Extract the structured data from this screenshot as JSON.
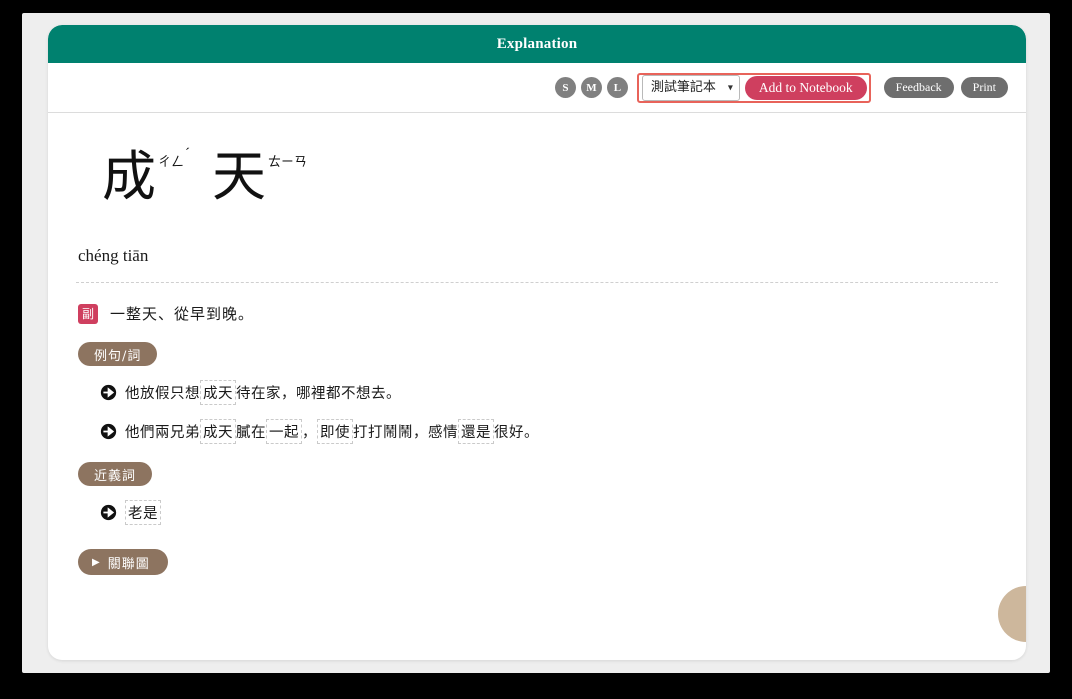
{
  "header": {
    "title": "Explanation"
  },
  "toolbar": {
    "size_buttons": [
      {
        "label": "S",
        "name": "font-size-small"
      },
      {
        "label": "M",
        "name": "font-size-medium"
      },
      {
        "label": "L",
        "name": "font-size-large"
      }
    ],
    "notebook_select": {
      "value": "測試筆記本",
      "options": [
        "測試筆記本"
      ],
      "caret": "⌄"
    },
    "add_to_notebook_label": "Add to Notebook",
    "feedback_label": "Feedback",
    "print_label": "Print",
    "focus_outline_color": "#e8635a",
    "accent_color": "#cf3f5f"
  },
  "entry": {
    "headword_chars": [
      {
        "char": "成",
        "zhuyin": "ㄔㄥ",
        "tone": "ˊ"
      },
      {
        "char": "天",
        "zhuyin": "ㄊㄧㄢ",
        "tone": ""
      }
    ],
    "pinyin": "chéng tiān",
    "part_of_speech_badge": "副",
    "definition": "一整天、從早到晚。",
    "examples_section_label": "例句/詞",
    "examples": [
      {
        "parts": [
          {
            "text": "他放假只想",
            "highlight": false
          },
          {
            "text": "成天",
            "highlight": true
          },
          {
            "text": "待在家，哪裡都不想去。",
            "highlight": false
          }
        ]
      },
      {
        "parts": [
          {
            "text": "他們兩兄弟",
            "highlight": false
          },
          {
            "text": "成天",
            "highlight": true
          },
          {
            "text": "膩在",
            "highlight": false
          },
          {
            "text": "一起",
            "highlight": true
          },
          {
            "text": "，",
            "highlight": false
          },
          {
            "text": "即使",
            "highlight": true
          },
          {
            "text": "打打鬧鬧，感情",
            "highlight": false
          },
          {
            "text": "還是",
            "highlight": true
          },
          {
            "text": "很好。",
            "highlight": false
          }
        ]
      }
    ],
    "synonyms_section_label": "近義詞",
    "synonyms": [
      {
        "parts": [
          {
            "text": "老是",
            "highlight": true
          }
        ]
      }
    ],
    "relation_graph_label": "關聯圖",
    "relation_graph_triangle": "▶"
  },
  "colors": {
    "header_teal": "#00816f",
    "badge_crimson": "#cf3f5f",
    "section_brown": "#8d7460",
    "pill_gray": "#6e6e6e",
    "corner_widget_tan": "#cdb79c"
  }
}
